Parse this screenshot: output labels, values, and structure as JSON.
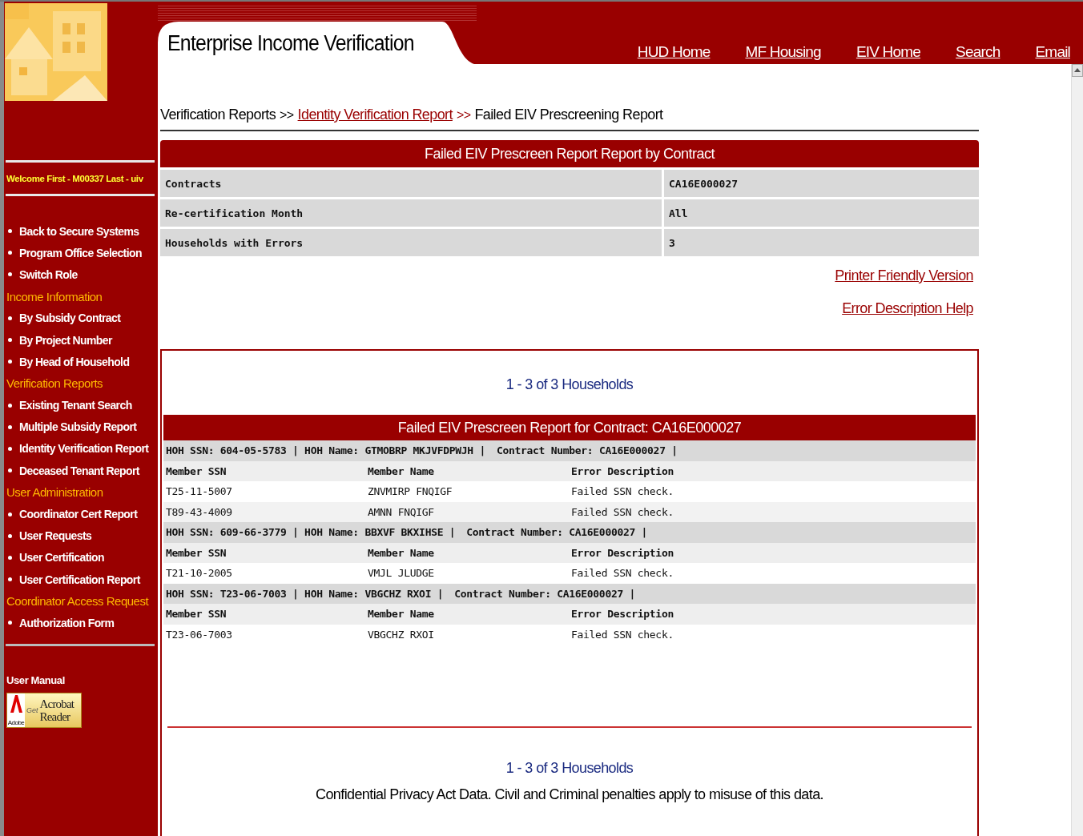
{
  "header": {
    "title": "Enterprise Income Verification",
    "nav": [
      "HUD Home",
      "MF Housing",
      "EIV Home",
      "Search",
      "Email"
    ]
  },
  "sidebar": {
    "welcome": "Welcome First - M00337 Last - uiv",
    "items": [
      {
        "kind": "link",
        "label": "Back to Secure Systems"
      },
      {
        "kind": "link",
        "label": "Program Office Selection"
      },
      {
        "kind": "link",
        "label": "Switch Role"
      },
      {
        "kind": "heading",
        "label": "Income Information"
      },
      {
        "kind": "link",
        "label": "By Subsidy Contract"
      },
      {
        "kind": "link",
        "label": "By Project Number"
      },
      {
        "kind": "link",
        "label": "By Head of Household"
      },
      {
        "kind": "heading",
        "label": "Verification Reports"
      },
      {
        "kind": "link",
        "label": "Existing Tenant Search"
      },
      {
        "kind": "link",
        "label": "Multiple Subsidy Report"
      },
      {
        "kind": "link",
        "label": "Identity Verification Report"
      },
      {
        "kind": "link",
        "label": "Deceased Tenant Report"
      },
      {
        "kind": "heading",
        "label": "User Administration"
      },
      {
        "kind": "link",
        "label": "Coordinator Cert Report"
      },
      {
        "kind": "link",
        "label": "User Requests"
      },
      {
        "kind": "link",
        "label": "User Certification"
      },
      {
        "kind": "link",
        "label": "User Certification Report"
      },
      {
        "kind": "heading",
        "label": "Coordinator Access Request"
      },
      {
        "kind": "link",
        "label": "Authorization Form"
      }
    ],
    "manual": "User Manual",
    "acrobat": {
      "brand": "Adobe",
      "get": "Get",
      "product": "Acrobat",
      "product2": "Reader"
    }
  },
  "breadcrumb": [
    {
      "kind": "text",
      "label": "Verification Reports"
    },
    {
      "kind": "sep",
      "label": ">>"
    },
    {
      "kind": "link",
      "label": "Identity Verification Report"
    },
    {
      "kind": "sep",
      "label": ">>"
    },
    {
      "kind": "text",
      "label": "Failed EIV Prescreening Report"
    }
  ],
  "summary": {
    "title": "Failed EIV Prescreen Report Report by Contract",
    "rows": [
      {
        "label": "Contracts",
        "value": "CA16E000027"
      },
      {
        "label": "Re-certification Month",
        "value": "All"
      },
      {
        "label": "Households with Errors",
        "value": "3"
      }
    ]
  },
  "links": [
    "Printer Friendly Version",
    "Error Description Help"
  ],
  "report": {
    "pager_top": "1 - 3 of 3 Households",
    "title": "Failed EIV Prescreen Report for Contract: CA16E000027",
    "groups": [
      {
        "hoh": "HOH SSN: 604-05-5783 | HOH Name: GTMOBRP MKJVFDPWJH |",
        "contract": "Contract Number: CA16E000027 |",
        "columns": [
          "Member SSN",
          "Member Name",
          "Error Description"
        ],
        "rows": [
          [
            "T25-11-5007",
            "ZNVMIRP FNQIGF",
            "Failed SSN check."
          ],
          [
            "T89-43-4009",
            "AMNN FNQIGF",
            "Failed SSN check."
          ]
        ]
      },
      {
        "hoh": "HOH SSN: 609-66-3779 | HOH Name: BBXVF BKXIHSE |",
        "contract": "Contract Number: CA16E000027 |",
        "columns": [
          "Member SSN",
          "Member Name",
          "Error Description"
        ],
        "rows": [
          [
            "T21-10-2005",
            "VMJL JLUDGE",
            "Failed SSN check."
          ]
        ]
      },
      {
        "hoh": "HOH SSN: T23-06-7003 | HOH Name: VBGCHZ RXOI |",
        "contract": "Contract Number: CA16E000027 |",
        "columns": [
          "Member SSN",
          "Member Name",
          "Error Description"
        ],
        "rows": [
          [
            "T23-06-7003",
            "VBGCHZ RXOI",
            "Failed SSN check."
          ]
        ]
      }
    ],
    "pager_bottom": "1 - 3 of 3 Households",
    "notice": "Confidential Privacy Act Data. Civil and Criminal penalties apply to misuse of this data."
  }
}
